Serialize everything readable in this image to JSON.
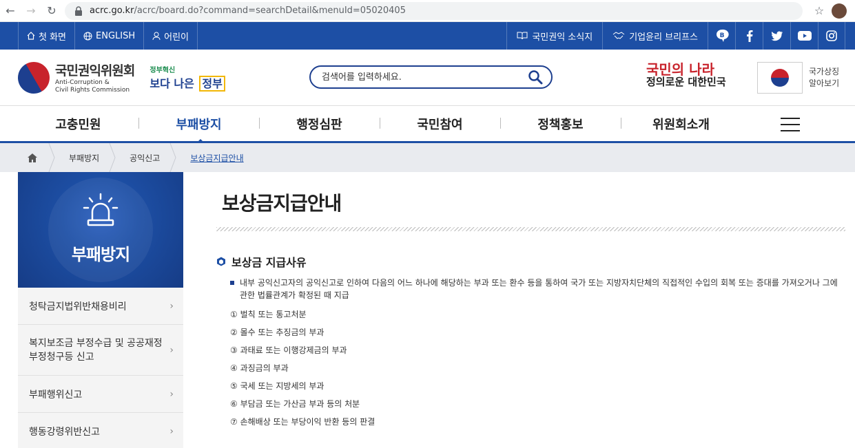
{
  "browser": {
    "url_host": "acrc.go.kr",
    "url_path": "/acrc/board.do?command=searchDetail&menuId=05020405"
  },
  "utilbar": {
    "left": [
      {
        "label": "첫 화면",
        "icon": "home-icon"
      },
      {
        "label": "ENGLISH",
        "icon": "globe-icon"
      },
      {
        "label": "어린이",
        "icon": "child-icon"
      }
    ],
    "right": [
      {
        "label": "국민권익 소식지",
        "icon": "book-icon"
      },
      {
        "label": "기업윤리 브리프스",
        "icon": "handshake-icon"
      }
    ],
    "sns": [
      "blog-icon",
      "facebook-icon",
      "twitter-icon",
      "youtube-icon",
      "instagram-icon"
    ]
  },
  "header": {
    "logo_ko": "국민권익위원회",
    "logo_en_1": "Anti-Corruption &",
    "logo_en_2": "Civil Rights Commission",
    "gov_small": "정부혁신",
    "gov_big_1": "보다 나은",
    "gov_big_2": "정부",
    "search_placeholder": "검색어를 입력하세요.",
    "slogan_1": "국민의 나라",
    "slogan_2": "정의로운 대한민국",
    "symbol_1": "국가상징",
    "symbol_2": "알아보기"
  },
  "gnb": {
    "items": [
      "고충민원",
      "부패방지",
      "행정심판",
      "국민참여",
      "정책홍보",
      "위원회소개"
    ],
    "active_index": 1
  },
  "breadcrumb": [
    "부패방지",
    "공익신고",
    "보상금지급안내"
  ],
  "lnb": {
    "title": "부패방지",
    "items": [
      "청탁금지법위반채용비리",
      "복지보조금 부정수급 및 공공재정 부정청구등 신고",
      "부패행위신고",
      "행동강령위반신고"
    ]
  },
  "main": {
    "page_title": "보상금지급안내",
    "section_title": "보상금 지급사유",
    "reason": "내부 공익신고자의 공익신고로 인하여 다음의 어느 하나에 해당하는 부과 또는 환수 등을 통하여 국가 또는 지방자치단체의 직접적인 수입의 회복 또는 증대를 가져오거나 그에 관한 법률관계가 확정된 때 지급",
    "list": [
      "① 벌칙 또는 통고처분",
      "② 몰수 또는 추징금의 부과",
      "③ 과태료 또는 이행강제금의 부과",
      "④ 과징금의 부과",
      "⑤ 국세 또는 지방세의 부과",
      "⑥ 부담금 또는 가산금 부과 등의 처분",
      "⑦ 손해배상 또는 부당이익 반환 등의 판결"
    ]
  },
  "colors": {
    "brand_blue": "#1d4fa5",
    "dark_navy": "#1d3f8f",
    "red": "#c8232c"
  }
}
